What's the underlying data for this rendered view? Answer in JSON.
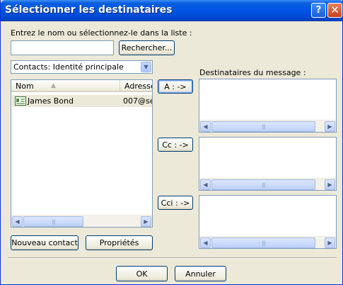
{
  "window": {
    "title": "Sélectionner les destinataires"
  },
  "prompt": "Entrez le nom ou sélectionnez-le dans la liste :",
  "search": {
    "value": "",
    "button": "Rechercher..."
  },
  "addressbook": {
    "selected": "Contacts: Identité principale"
  },
  "contacts": {
    "columns": [
      "Nom",
      "Adresse"
    ],
    "rows": [
      {
        "name": "James Bond",
        "address": "007@se"
      }
    ]
  },
  "recipients": {
    "label": "Destinataires du message :",
    "to_button": "A : ->",
    "cc_button": "Cc : ->",
    "bcc_button": "Cci : ->"
  },
  "actions": {
    "new_contact": "Nouveau contact",
    "properties": "Propriétés"
  },
  "footer": {
    "ok": "OK",
    "cancel": "Annuler"
  },
  "icons": {
    "sort": "sort-ascending-icon",
    "contact": "contact-card-icon",
    "scroll_left": "arrow-left-icon",
    "scroll_right": "arrow-right-icon",
    "dropdown": "chevron-down-icon"
  }
}
